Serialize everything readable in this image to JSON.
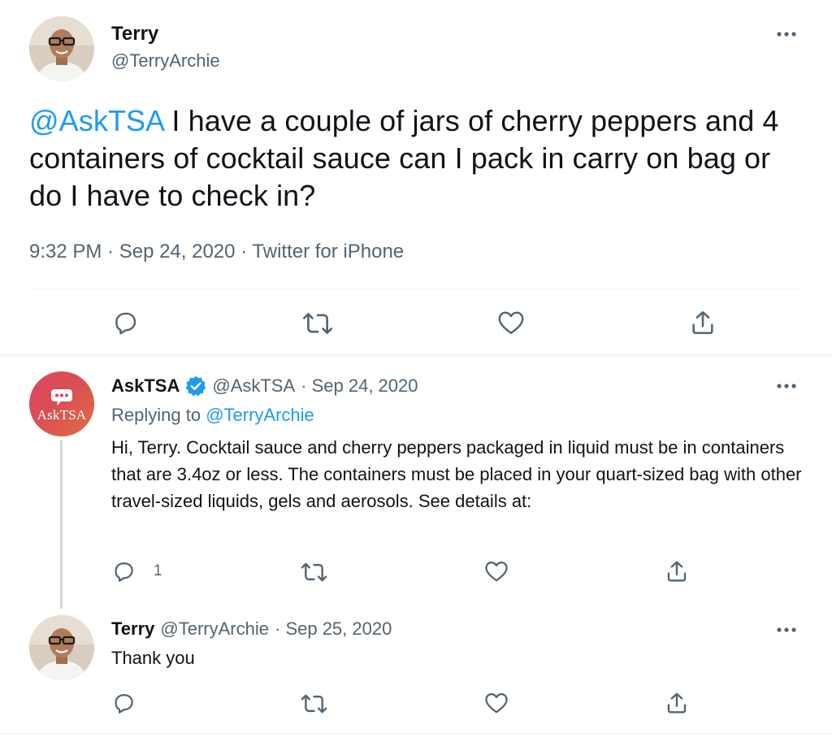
{
  "colors": {
    "accent": "#1d9bf0",
    "text": "#0f1419",
    "secondary": "#536471"
  },
  "main_tweet": {
    "author_name": "Terry",
    "author_handle": "@TerryArchie",
    "mention": "@AskTSA",
    "text": " I have a couple of jars of cherry peppers and 4 containers of cocktail sauce can I pack in carry on bag or do I have to check in?",
    "meta": "9:32 PM · Sep 24, 2020 · Twitter for iPhone",
    "icons": {
      "more": "more-icon",
      "reply": "reply-icon",
      "retweet": "retweet-icon",
      "like": "heart-icon",
      "share": "share-icon"
    }
  },
  "replies": [
    {
      "author_name": "AskTSA",
      "verified": true,
      "author_handle": "@AskTSA",
      "date": "· Sep 24, 2020",
      "avatar_text": "AskTSA",
      "replying_prefix": "Replying to ",
      "replying_to": "@TerryArchie",
      "text": "Hi, Terry. Cocktail sauce and cherry peppers packaged in liquid must be in containers that are 3.4oz or less. The containers must be placed in your quart-sized bag with other travel-sized liquids, gels and aerosols. See details at:",
      "reply_count": "1"
    },
    {
      "author_name": "Terry",
      "author_handle": "@TerryArchie",
      "date": "· Sep 25, 2020",
      "text": "Thank you"
    }
  ]
}
